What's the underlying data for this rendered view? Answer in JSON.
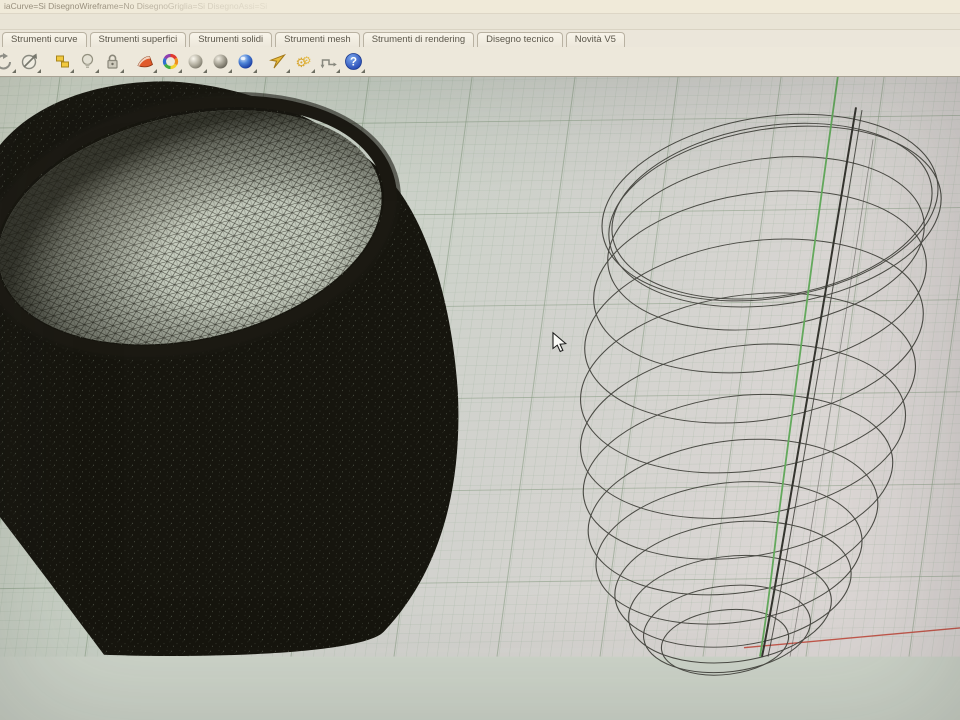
{
  "titlebar": {
    "text": "iaCurve=Si   DisegnoWireframe=No   DisegnoGriglia=Si   DisegnoAssi=Si"
  },
  "command_line": {
    "value": ""
  },
  "tabs": [
    "Strumenti curve",
    "Strumenti superfici",
    "Strumenti solidi",
    "Strumenti mesh",
    "Strumenti di rendering",
    "Disegno tecnico",
    "Novità V5"
  ],
  "toolbar": {
    "icons": [
      {
        "name": "undo-arc-icon",
        "group": 1
      },
      {
        "name": "zoom-circle-arrow-icon",
        "group": 1
      },
      {
        "name": "layer-boxes-icon",
        "group": 2
      },
      {
        "name": "lightbulb-icon",
        "group": 2
      },
      {
        "name": "padlock-icon",
        "group": 2
      },
      {
        "name": "shaded-wedge-icon",
        "group": 3
      },
      {
        "name": "color-wheel-icon",
        "group": 3
      },
      {
        "name": "sphere-matte-icon",
        "group": 3
      },
      {
        "name": "sphere-metal-icon",
        "group": 3
      },
      {
        "name": "sphere-render-icon",
        "group": 3
      },
      {
        "name": "pointer-arrow-icon",
        "group": 4
      },
      {
        "name": "gears-icon",
        "group": 4
      },
      {
        "name": "history-connector-icon",
        "group": 4
      },
      {
        "name": "help-icon",
        "group": 4
      }
    ]
  },
  "viewport": {
    "grid_color_minor": "#9cb29c",
    "grid_color_major": "#84997f",
    "axis_green": "#63a95c",
    "axis_red": "#c2574b",
    "wire_color": "#4b4b45"
  }
}
